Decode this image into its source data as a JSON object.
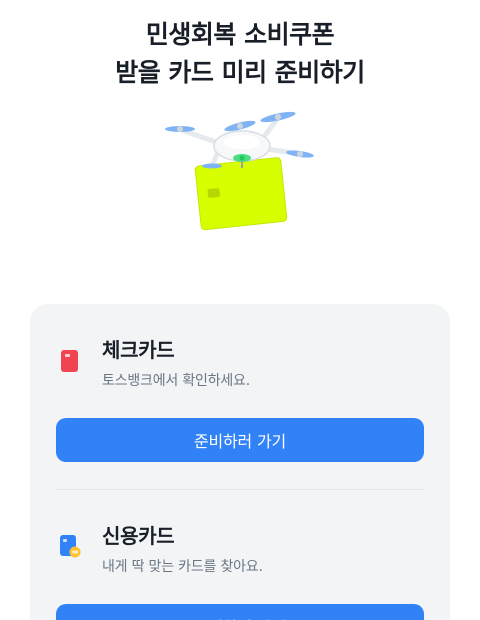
{
  "headline": {
    "line1": "민생회복 소비쿠폰",
    "line2": "받을 카드 미리 준비하기"
  },
  "hero": {
    "icon": "drone-carrying-card"
  },
  "options": [
    {
      "icon": "check-card-icon",
      "title": "체크카드",
      "subtitle": "토스뱅크에서 확인하세요.",
      "button": "준비하러 가기"
    },
    {
      "icon": "credit-card-icon",
      "title": "신용카드",
      "subtitle": "내게 딱 맞는 카드를 찾아요.",
      "button": "준비하러 가기"
    }
  ],
  "colors": {
    "primary": "#3182f6",
    "panel_bg": "#f2f4f6",
    "title_text": "#191f28",
    "sub_text": "#6b7684",
    "card_lime": "#d8ff00",
    "check_icon": "#f04452"
  }
}
